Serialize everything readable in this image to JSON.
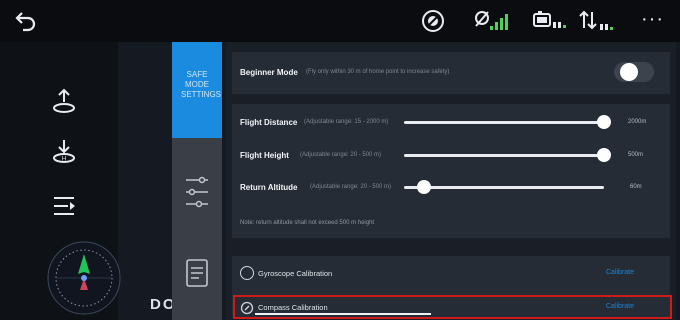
{
  "topbar": {
    "icons": [
      "back-icon",
      "gps-icon",
      "aircraft-signal-icon",
      "battery-icon",
      "transmission-icon",
      "more-icon"
    ],
    "more_label": "···"
  },
  "left_rail": {
    "icons": [
      "takeoff-icon",
      "return-home-icon",
      "flight-list-icon",
      "compass-icon"
    ],
    "bottom_text": "DO"
  },
  "tabs": {
    "active_label": "SAFE MODE SETTINGS",
    "items": [
      "safety-tab",
      "control-tab",
      "settings-tab"
    ]
  },
  "settings": {
    "beginner_mode": {
      "label": "Beginner Mode",
      "desc": "(Fly only within 30 m of home point to increase safety)",
      "enabled": false
    },
    "flight_distance": {
      "label": "Flight Distance",
      "desc": "(Adjustable range: 15 - 2000 m)",
      "value": "2000m",
      "level": 1.0
    },
    "flight_height": {
      "label": "Flight Height",
      "desc": "(Adjustable range: 20 - 500 m)",
      "value": "500m",
      "level": 1.0
    },
    "return_altitude": {
      "label": "Return Altitude",
      "desc": "(Adjustable range: 20 - 500 m)",
      "value": "60m",
      "level": 0.1
    },
    "note": "Note: return altitude shall not exceed 500 m height"
  },
  "calibration": {
    "gyroscope": {
      "label": "Gyroscope Calibration",
      "link": "Calibrate"
    },
    "compass": {
      "label": "Compass Calibration",
      "link": "Calibrate"
    }
  },
  "colors": {
    "accent": "#1b8be0",
    "highlight": "#d01b1b"
  }
}
